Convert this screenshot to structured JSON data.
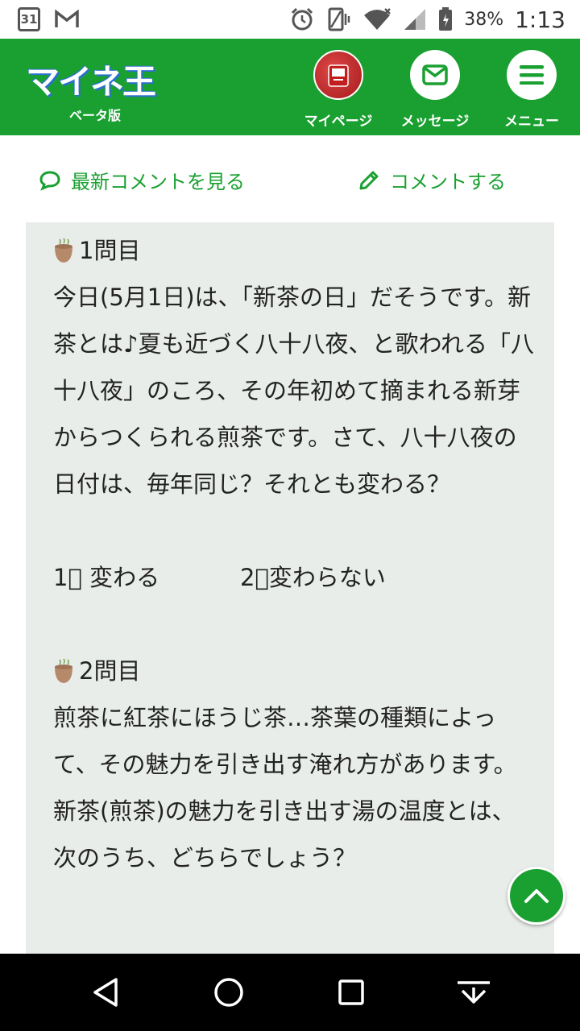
{
  "status_bar": {
    "calendar_day": "31",
    "battery_percent": "38%",
    "time": "1:13"
  },
  "header": {
    "logo_text": "マイネ王",
    "logo_sub": "ベータ版",
    "nav": [
      {
        "label": "マイページ",
        "icon": "avatar"
      },
      {
        "label": "メッセージ",
        "icon": "envelope-icon"
      },
      {
        "label": "メニュー",
        "icon": "hamburger-icon"
      }
    ]
  },
  "actions": {
    "latest_comments": "最新コメントを見る",
    "write_comment": "コメントする"
  },
  "post": {
    "q1_title": "1問目",
    "q1_body": "今日(5月1日)は、「新茶の日」だそうです。新茶とは♪夏も近づく八十八夜、と歌われる「八十八夜」のころ、その年初めて摘まれる新芽からつくられる煎茶です。さて、八十八夜の日付は、毎年同じ？それとも変わる？",
    "q1_opt1": "1⃣ 変わる",
    "q1_opt2": "2⃣変わらない",
    "q2_title": "2問目",
    "q2_body": "煎茶に紅茶にほうじ茶…茶葉の種類によって、その魅力を引き出す淹れ方があります。新茶(煎茶)の魅力を引き出す湯の温度とは、次のうち、どちらでしょう？"
  },
  "colors": {
    "brand_green": "#1aa031",
    "content_bg": "#e9ede9"
  }
}
